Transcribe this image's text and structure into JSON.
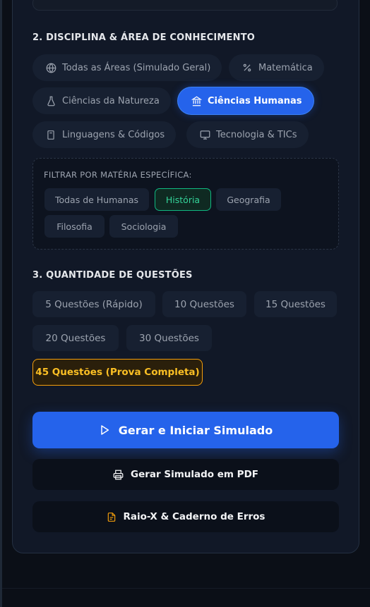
{
  "section2": {
    "title": "2. DISCIPLINA & ÁREA DE CONHECIMENTO",
    "areas": [
      {
        "label": "Todas as Áreas (Simulado Geral)",
        "icon": "globe-icon"
      },
      {
        "label": "Matemática",
        "icon": "percent-icon"
      },
      {
        "label": "Ciências da Natureza",
        "icon": "flask-icon"
      },
      {
        "label": "Ciências Humanas",
        "icon": "landmark-icon",
        "selected": true
      },
      {
        "label": "Linguagens & Códigos",
        "icon": "book-icon"
      },
      {
        "label": "Tecnologia & TICs",
        "icon": "monitor-icon"
      }
    ],
    "filter": {
      "title": "FILTRAR POR MATÉRIA ESPECÍFICA:",
      "subjects": [
        {
          "label": "Todas de Humanas"
        },
        {
          "label": "História",
          "selected": true
        },
        {
          "label": "Geografia"
        },
        {
          "label": "Filosofia"
        },
        {
          "label": "Sociologia"
        }
      ]
    }
  },
  "section3": {
    "title": "3. QUANTIDADE DE QUESTÕES",
    "options": [
      {
        "label": "5 Questões (Rápido)"
      },
      {
        "label": "10 Questões"
      },
      {
        "label": "15 Questões"
      },
      {
        "label": "20 Questões"
      },
      {
        "label": "30 Questões"
      },
      {
        "label": "45 Questões (Prova Completa)",
        "selected": true
      }
    ]
  },
  "actions": {
    "start_label": "Gerar e Iniciar Simulado",
    "pdf_label": "Gerar Simulado em PDF",
    "xray_label": "Raio-X & Caderno de Erros"
  },
  "colors": {
    "accent": "#2563eb",
    "success": "#10b981",
    "warning": "#f59e0b"
  }
}
